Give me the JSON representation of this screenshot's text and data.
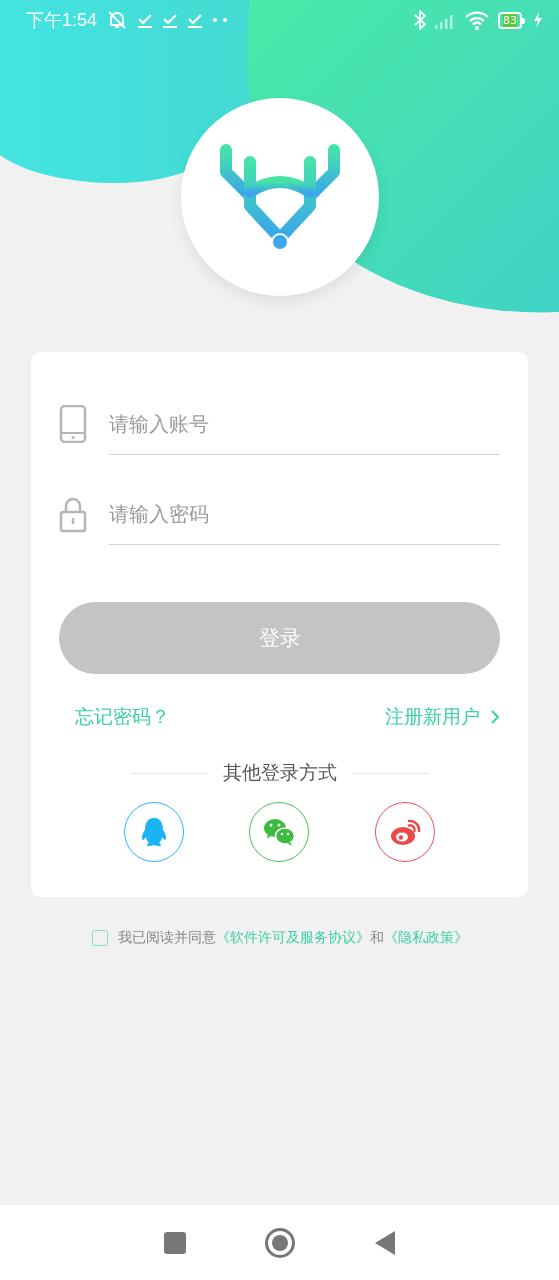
{
  "status_bar": {
    "time": "下午1:54",
    "battery": "83",
    "charging": true
  },
  "login_form": {
    "account_field": {
      "placeholder": "请输入账号"
    },
    "password_field": {
      "placeholder": "请输入密码"
    },
    "login_button": {
      "label": "登录",
      "disabled": true
    },
    "forgot_link": "忘记密码？",
    "register_link": "注册新用户",
    "other_login_label": "其他登录方式",
    "third_party": [
      {
        "kind": "qq"
      },
      {
        "kind": "wechat"
      },
      {
        "kind": "weibo"
      }
    ]
  },
  "agreement": {
    "checked": false,
    "prefix": "我已阅读并同意",
    "license_link": "《软件许可及服务协议》",
    "joiner": "和",
    "privacy_link": "《隐私政策》"
  }
}
